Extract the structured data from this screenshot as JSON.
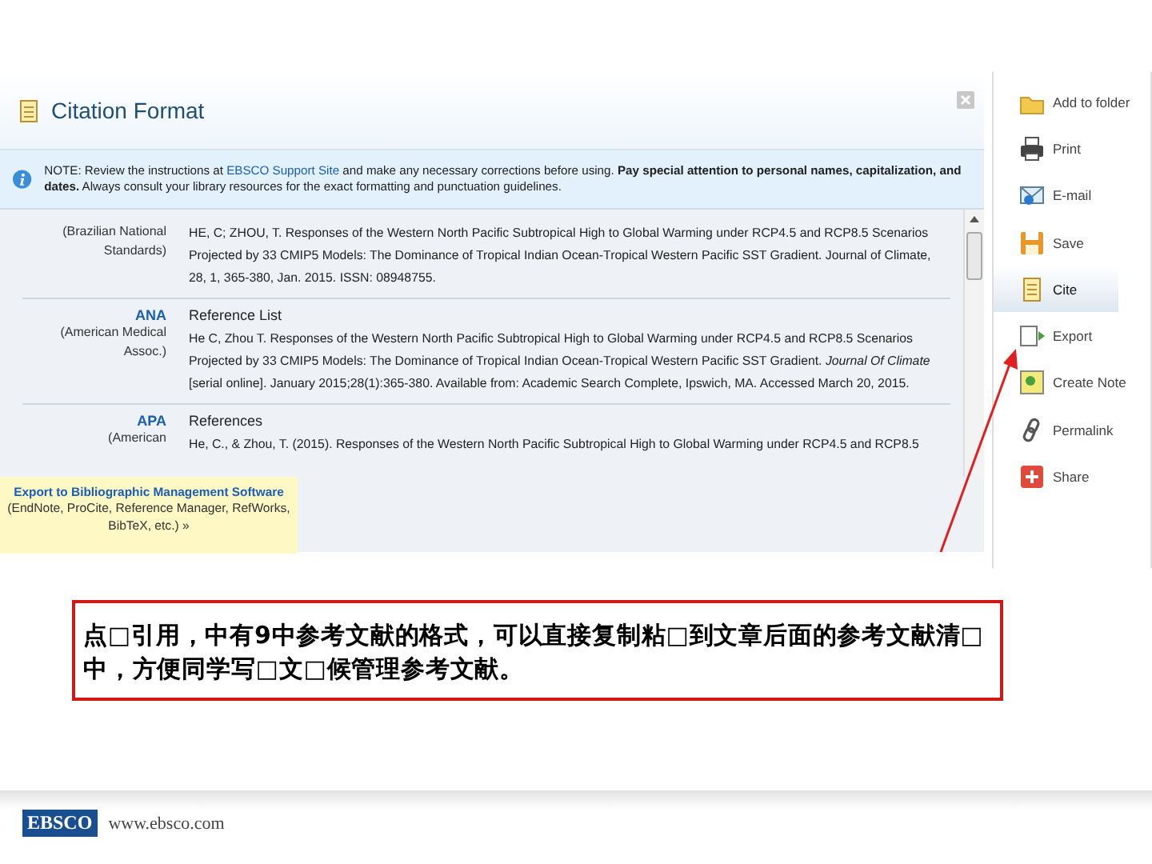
{
  "dialog": {
    "title": "Citation Format",
    "note": {
      "before": "NOTE: Review the instructions at",
      "link": "EBSCO Support Site",
      "after": "and make any necessary corrections before using. **Pay special attention to personal names, capitalization, and dates.** Always consult your library resources for the exact formatting and punctuation guidelines."
    },
    "citations": [
      {
        "style_full": "(Brazilian National Standards)",
        "text": "HE, C; ZHOU, T. Responses of the Western North Pacific Subtropical High to Global Warming under RCP4.5 and RCP8.5 Scenarios Projected by 33 CMIP5 Models: The Dominance of Tropical Indian Ocean-Tropical Western Pacific SST Gradient. Journal of Climate, 28, 1, 365-380, Jan. 2015. ISSN: 08948755."
      },
      {
        "style": "ANA",
        "style_full": "(American Medical Assoc.)",
        "heading": "Reference List",
        "text": "He C, Zhou T. Responses of the Western North Pacific Subtropical High to Global Warming under RCP4.5 and RCP8.5 Scenarios Projected by 33 CMIP5 Models: The Dominance of Tropical Indian Ocean-Tropical Western Pacific SST Gradient. *Journal Of Climate* [serial online]. January 2015;28(1):365-380. Available from: Academic Search Complete, Ipswich, MA. Accessed March 20, 2015."
      },
      {
        "style": "APA",
        "style_full": "(American",
        "heading": "References",
        "text": "He, C., & Zhou, T. (2015). Responses of the Western North Pacific Subtropical High to Global Warming under RCP4.5 and RCP8.5"
      }
    ],
    "export": {
      "title": "Export to Bibliographic Management Software",
      "detail": "(EndNote, ProCite, Reference Manager, RefWorks, BibTeX, etc.) »"
    }
  },
  "sidebar": {
    "items": [
      {
        "label": "Add to folder",
        "selected": false
      },
      {
        "label": "Print",
        "selected": false
      },
      {
        "label": "E-mail",
        "selected": false
      },
      {
        "label": "Save",
        "selected": false
      },
      {
        "label": "Cite",
        "selected": true
      },
      {
        "label": "Export",
        "selected": false
      },
      {
        "label": "Create Note",
        "selected": false
      },
      {
        "label": "Permalink",
        "selected": false
      },
      {
        "label": "Share",
        "selected": false
      }
    ]
  },
  "caption": "点□引用，中有9中参考文献的格式，可以直接复制粘□到文章后面的参考文献清□中，方便同学写□文□候管理参考文献。",
  "footer": {
    "logo": "EBSCO",
    "url": "www.ebsco.com"
  }
}
